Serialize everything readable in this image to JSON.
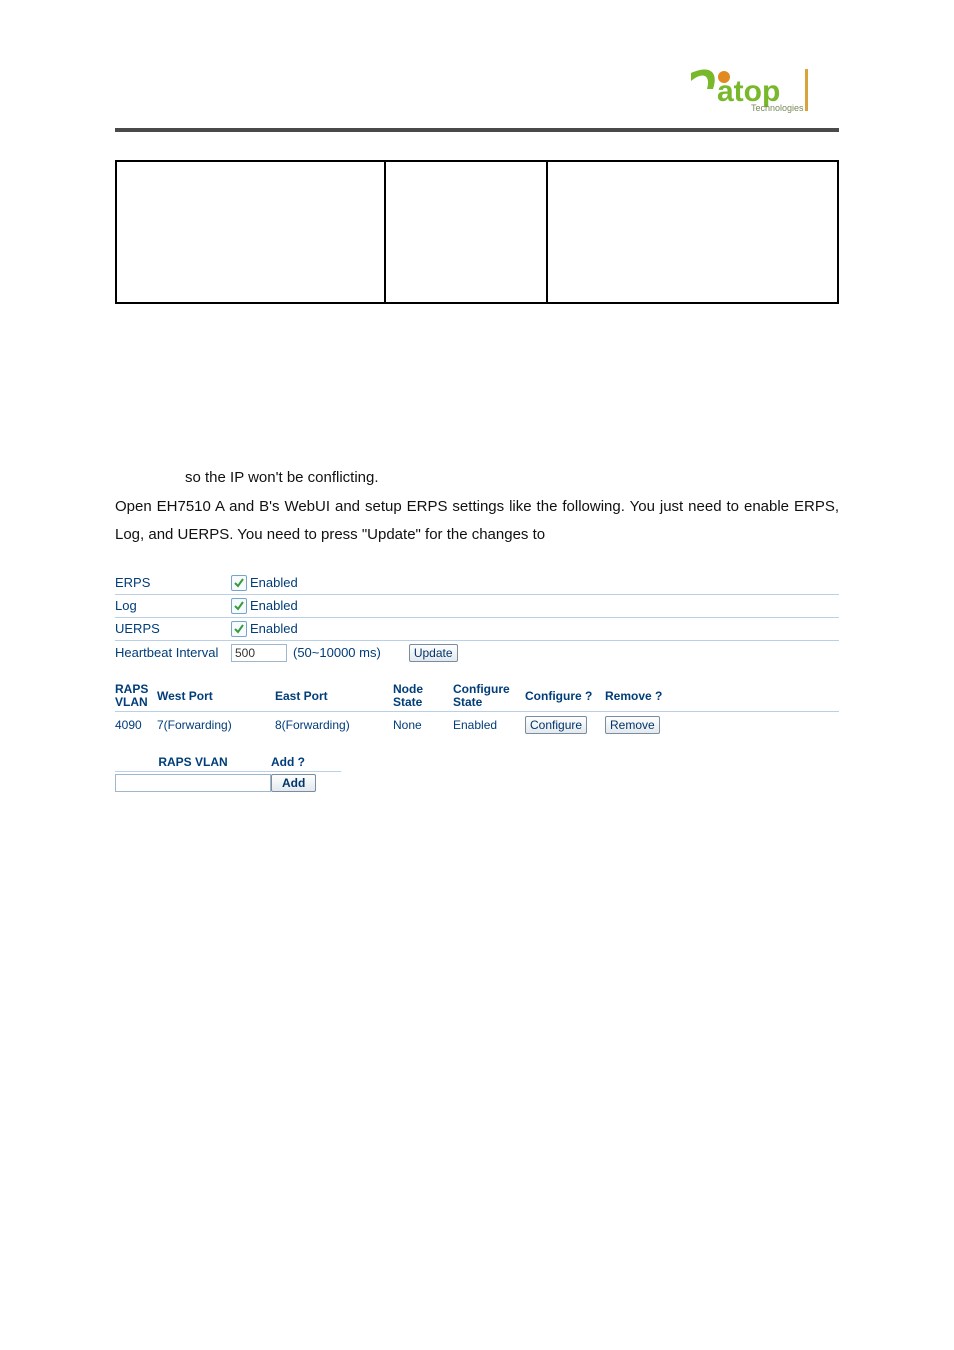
{
  "logo": {
    "brand_text": "atop",
    "subtext": "Technologies"
  },
  "body": {
    "line1": "so the IP won't be conflicting.",
    "line2_part": "Open EH7510 A and B's WebUI and setup ERPS settings like the following. You just need to enable ERPS, Log, and UERPS. You need to press \"Update\" for the changes to"
  },
  "settings": {
    "rows": [
      {
        "label": "ERPS",
        "type": "checkbox",
        "checked": true,
        "caption": "Enabled"
      },
      {
        "label": "Log",
        "type": "checkbox",
        "checked": true,
        "caption": "Enabled"
      },
      {
        "label": "UERPS",
        "type": "checkbox",
        "checked": true,
        "caption": "Enabled"
      }
    ],
    "heartbeat_label": "Heartbeat Interval",
    "heartbeat_value": "500",
    "heartbeat_hint": "(50~10000 ms)",
    "update_btn": "Update"
  },
  "erps_table": {
    "headers": {
      "vlan": "RAPS VLAN",
      "west": "West Port",
      "east": "East Port",
      "node": "Node State",
      "cfgstate": "Configure State",
      "cfgq": "Configure ?",
      "rmvq": "Remove ?"
    },
    "row": {
      "vlan": "4090",
      "west": "7(Forwarding)",
      "east": "8(Forwarding)",
      "node": "None",
      "cfgstate": "Enabled",
      "cfg_btn": "Configure",
      "rmv_btn": "Remove"
    }
  },
  "add_block": {
    "raps_label": "RAPS VLAN",
    "add_label": "Add ?",
    "raps_value": "",
    "add_btn": "Add"
  }
}
